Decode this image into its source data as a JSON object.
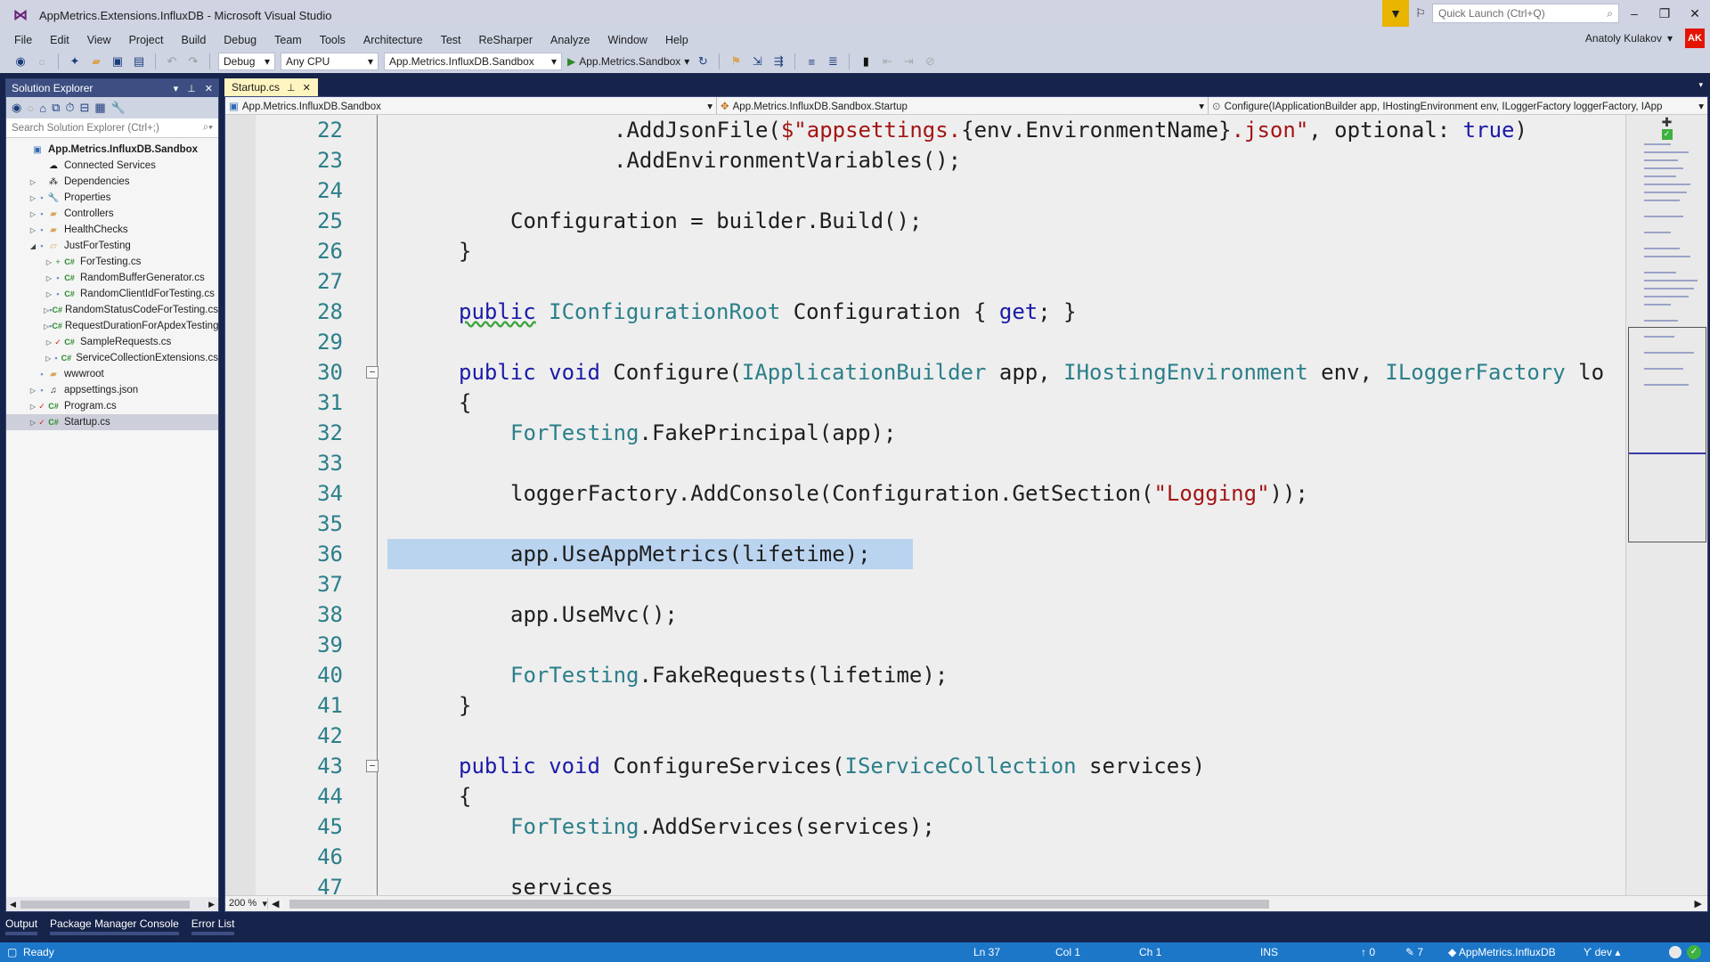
{
  "window": {
    "title": "AppMetrics.Extensions.InfluxDB - Microsoft Visual Studio",
    "quick_launch_placeholder": "Quick Launch (Ctrl+Q)",
    "user_name": "Anatoly Kulakov",
    "user_initials": "AK"
  },
  "menu": [
    "File",
    "Edit",
    "View",
    "Project",
    "Build",
    "Debug",
    "Team",
    "Tools",
    "Architecture",
    "Test",
    "ReSharper",
    "Analyze",
    "Window",
    "Help"
  ],
  "toolbar": {
    "configuration": "Debug",
    "platform": "Any CPU",
    "startup_project": "App.Metrics.InfluxDB.Sandbox",
    "run_target": "App.Metrics.Sandbox"
  },
  "solution_explorer": {
    "title": "Solution Explorer",
    "search_placeholder": "Search Solution Explorer (Ctrl+;)",
    "items": [
      {
        "label": "App.Metrics.InfluxDB.Sandbox",
        "depth": 0,
        "arrow": "",
        "icon": "project",
        "bold": true
      },
      {
        "label": "Connected Services",
        "depth": 1,
        "arrow": "",
        "icon": "cloud"
      },
      {
        "label": "Dependencies",
        "depth": 1,
        "arrow": "collapsed",
        "icon": "deps"
      },
      {
        "label": "Properties",
        "depth": 1,
        "arrow": "collapsed",
        "icon": "wrench",
        "badge": "lock"
      },
      {
        "label": "Controllers",
        "depth": 1,
        "arrow": "collapsed",
        "icon": "folder",
        "badge": "lock"
      },
      {
        "label": "HealthChecks",
        "depth": 1,
        "arrow": "collapsed",
        "icon": "folder",
        "badge": "lock"
      },
      {
        "label": "JustForTesting",
        "depth": 1,
        "arrow": "expanded",
        "icon": "folder-open",
        "badge": "lock"
      },
      {
        "label": "ForTesting.cs",
        "depth": 2,
        "arrow": "collapsed",
        "icon": "cs",
        "badge": "plus"
      },
      {
        "label": "RandomBufferGenerator.cs",
        "depth": 2,
        "arrow": "collapsed",
        "icon": "cs",
        "badge": "lock"
      },
      {
        "label": "RandomClientIdForTesting.cs",
        "depth": 2,
        "arrow": "collapsed",
        "icon": "cs",
        "badge": "lock"
      },
      {
        "label": "RandomStatusCodeForTesting.cs",
        "depth": 2,
        "arrow": "collapsed",
        "icon": "cs",
        "badge": "lock"
      },
      {
        "label": "RequestDurationForApdexTesting.cs",
        "depth": 2,
        "arrow": "collapsed",
        "icon": "cs",
        "badge": "lock"
      },
      {
        "label": "SampleRequests.cs",
        "depth": 2,
        "arrow": "collapsed",
        "icon": "cs",
        "badge": "check"
      },
      {
        "label": "ServiceCollectionExtensions.cs",
        "depth": 2,
        "arrow": "collapsed",
        "icon": "cs",
        "badge": "lock"
      },
      {
        "label": "wwwroot",
        "depth": 1,
        "arrow": "",
        "icon": "folder-web",
        "badge": "lock"
      },
      {
        "label": "appsettings.json",
        "depth": 1,
        "arrow": "collapsed",
        "icon": "json",
        "badge": "lock"
      },
      {
        "label": "Program.cs",
        "depth": 1,
        "arrow": "collapsed",
        "icon": "cs",
        "badge": "check"
      },
      {
        "label": "Startup.cs",
        "depth": 1,
        "arrow": "collapsed",
        "icon": "cs",
        "badge": "check",
        "selected": true
      }
    ]
  },
  "editor": {
    "tab_label": "Startup.cs",
    "nav_project": "App.Metrics.InfluxDB.Sandbox",
    "nav_type": "App.Metrics.InfluxDB.Sandbox.Startup",
    "nav_member": "Configure(IApplicationBuilder app, IHostingEnvironment env, ILoggerFactory loggerFactory, IApp",
    "zoom": "200 %",
    "lines": [
      {
        "n": "22",
        "indent": 4,
        "tokens": [
          [
            ".AddJsonFile(",
            ""
          ],
          [
            "$\"appsettings.",
            "st"
          ],
          [
            "{env.EnvironmentName}",
            ""
          ],
          [
            ".json\"",
            "st"
          ],
          [
            ", optional: ",
            ""
          ],
          [
            "true",
            "kw"
          ],
          [
            ")",
            ""
          ]
        ]
      },
      {
        "n": "23",
        "indent": 4,
        "tokens": [
          [
            ".AddEnvironmentVariables();",
            ""
          ]
        ]
      },
      {
        "n": "24",
        "indent": 0,
        "tokens": []
      },
      {
        "n": "25",
        "indent": 2,
        "tokens": [
          [
            "Configuration = builder.Build();",
            ""
          ]
        ]
      },
      {
        "n": "26",
        "indent": 1,
        "tokens": [
          [
            "}",
            ""
          ]
        ]
      },
      {
        "n": "27",
        "indent": 0,
        "tokens": []
      },
      {
        "n": "28",
        "indent": 1,
        "tokens": [
          [
            "public",
            "kw squig"
          ],
          [
            " ",
            ""
          ],
          [
            "IConfigurationRoot",
            "ty"
          ],
          [
            " Configuration { ",
            ""
          ],
          [
            "get",
            "kw"
          ],
          [
            "; }",
            ""
          ]
        ]
      },
      {
        "n": "29",
        "indent": 0,
        "tokens": []
      },
      {
        "n": "30",
        "indent": 1,
        "fold": true,
        "tokens": [
          [
            "public",
            "kw"
          ],
          [
            " ",
            ""
          ],
          [
            "void",
            "kw"
          ],
          [
            " Configure(",
            ""
          ],
          [
            "IApplicationBuilder",
            "ty"
          ],
          [
            " app, ",
            ""
          ],
          [
            "IHostingEnvironment",
            "ty"
          ],
          [
            " env, ",
            ""
          ],
          [
            "ILoggerFactory",
            "ty"
          ],
          [
            " lo",
            ""
          ]
        ]
      },
      {
        "n": "31",
        "indent": 1,
        "tokens": [
          [
            "{",
            ""
          ]
        ]
      },
      {
        "n": "32",
        "indent": 2,
        "tokens": [
          [
            "ForTesting",
            "ty"
          ],
          [
            ".FakePrincipal(app);",
            ""
          ]
        ]
      },
      {
        "n": "33",
        "indent": 0,
        "tokens": []
      },
      {
        "n": "34",
        "indent": 2,
        "tokens": [
          [
            "loggerFactory.AddConsole(Configuration.GetSection(",
            ""
          ],
          [
            "\"Logging\"",
            "st"
          ],
          [
            "));",
            ""
          ]
        ]
      },
      {
        "n": "35",
        "indent": 0,
        "tokens": []
      },
      {
        "n": "36",
        "indent": 2,
        "highlight": true,
        "tokens": [
          [
            "app.UseAppMetrics(lifetime);",
            ""
          ]
        ]
      },
      {
        "n": "37",
        "indent": 0,
        "tokens": []
      },
      {
        "n": "38",
        "indent": 2,
        "tokens": [
          [
            "app.UseMvc();",
            ""
          ]
        ]
      },
      {
        "n": "39",
        "indent": 0,
        "tokens": []
      },
      {
        "n": "40",
        "indent": 2,
        "tokens": [
          [
            "ForTesting",
            "ty"
          ],
          [
            ".FakeRequests(lifetime);",
            ""
          ]
        ]
      },
      {
        "n": "41",
        "indent": 1,
        "tokens": [
          [
            "}",
            ""
          ]
        ]
      },
      {
        "n": "42",
        "indent": 0,
        "tokens": []
      },
      {
        "n": "43",
        "indent": 1,
        "fold": true,
        "tokens": [
          [
            "public",
            "kw"
          ],
          [
            " ",
            ""
          ],
          [
            "void",
            "kw"
          ],
          [
            " ConfigureServices(",
            ""
          ],
          [
            "IServiceCollection",
            "ty"
          ],
          [
            " services)",
            ""
          ]
        ]
      },
      {
        "n": "44",
        "indent": 1,
        "tokens": [
          [
            "{",
            ""
          ]
        ]
      },
      {
        "n": "45",
        "indent": 2,
        "tokens": [
          [
            "ForTesting",
            "ty"
          ],
          [
            ".AddServices(services);",
            ""
          ]
        ]
      },
      {
        "n": "46",
        "indent": 0,
        "tokens": []
      },
      {
        "n": "47",
        "indent": 2,
        "tokens": [
          [
            "services",
            ""
          ]
        ]
      }
    ]
  },
  "tool_windows": [
    "Output",
    "Package Manager Console",
    "Error List"
  ],
  "status": {
    "state": "Ready",
    "line": "Ln 37",
    "col": "Col 1",
    "ch": "Ch 1",
    "mode": "INS",
    "push_count": "0",
    "changes_count": "7",
    "repo": "AppMetrics.InfluxDB",
    "branch": "dev"
  },
  "colors": {
    "accent": "#1c77c9",
    "keyword": "#1a1aa8",
    "type": "#2b7f8a",
    "string": "#a31515",
    "selection": "#bad4f0"
  }
}
